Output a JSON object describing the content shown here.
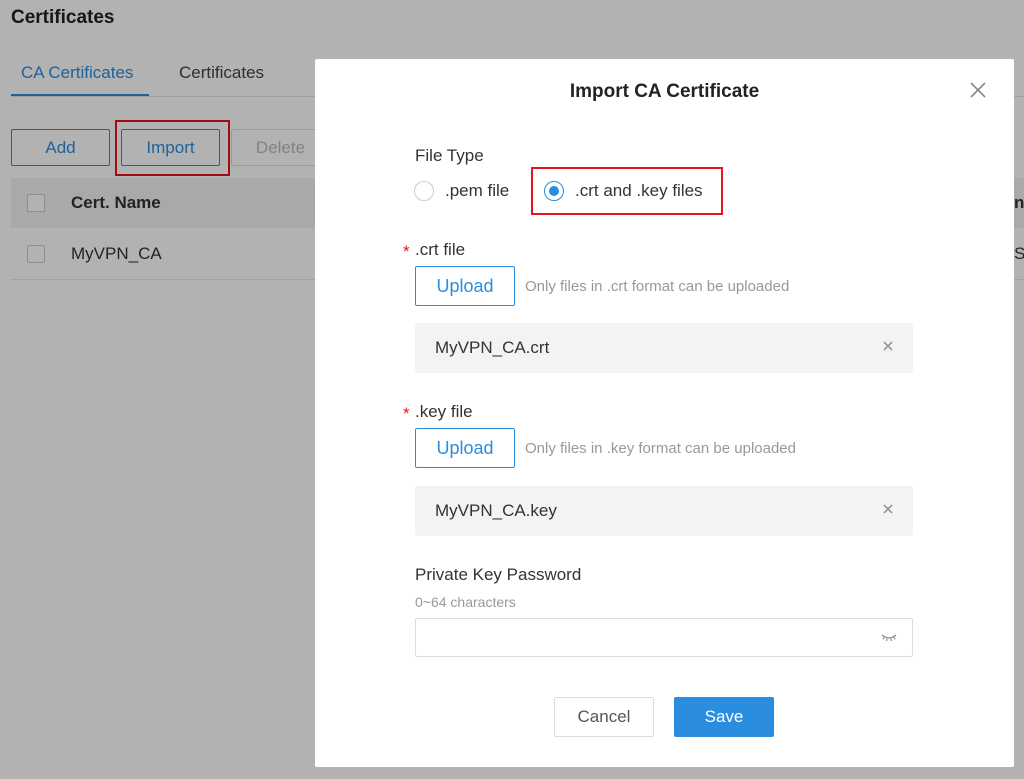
{
  "page": {
    "title": "Certificates",
    "tabs": [
      {
        "label": "CA Certificates",
        "active": true
      },
      {
        "label": "Certificates",
        "active": false
      }
    ],
    "toolbar": {
      "add": "Add",
      "import": "Import",
      "delete": "Delete"
    },
    "table": {
      "header": {
        "name": "Cert. Name",
        "partial": "n"
      },
      "rows": [
        {
          "name": "MyVPN_CA",
          "partial": "S"
        }
      ]
    }
  },
  "modal": {
    "title": "Import CA Certificate",
    "file_type": {
      "label": "File Type",
      "options": [
        {
          "label": ".pem file",
          "selected": false
        },
        {
          "label": ".crt and .key files",
          "selected": true
        }
      ]
    },
    "crt": {
      "required_mark": "*",
      "label": ".crt file",
      "upload": "Upload",
      "hint": "Only files in .crt format can be uploaded",
      "file": "MyVPN_CA.crt"
    },
    "key": {
      "required_mark": "*",
      "label": ".key file",
      "upload": "Upload",
      "hint": "Only files in .key format can be uploaded",
      "file": "MyVPN_CA.key"
    },
    "password": {
      "label": "Private Key Password",
      "hint": "0~64 characters",
      "value": ""
    },
    "buttons": {
      "cancel": "Cancel",
      "save": "Save"
    }
  },
  "colors": {
    "accent": "#2b8de0",
    "highlight": "#e8141b",
    "overlay": "rgba(0,0,0,0.30)"
  },
  "icons": {
    "close": "close-icon",
    "clear": "clear-icon",
    "eye": "eye-hidden-icon"
  }
}
